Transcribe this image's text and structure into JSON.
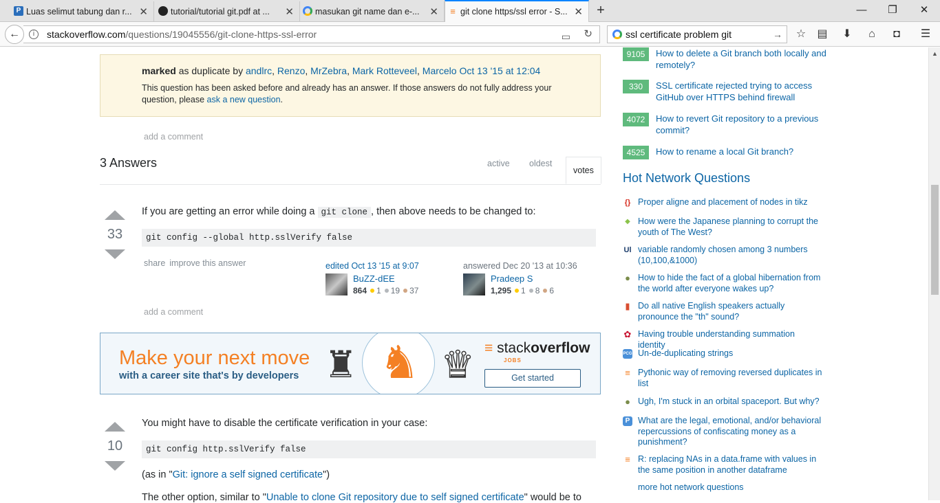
{
  "tabs": [
    {
      "title": "Luas selimut tabung dan r...",
      "icon": "p-icon",
      "color": "#2a6ebb"
    },
    {
      "title": "tutorial/tutorial git.pdf at ...",
      "icon": "github-icon",
      "color": "#222222"
    },
    {
      "title": "masukan git name dan e-...",
      "icon": "google-icon",
      "color": "#4285f4"
    },
    {
      "title": "git clone https/ssl error - S...",
      "icon": "stackoverflow-icon",
      "color": "#f48024"
    }
  ],
  "url": {
    "domain": "stackoverflow.com",
    "path": "/questions/19045556/git-clone-https-ssl-error"
  },
  "search": {
    "value": "ssl certificate problem git"
  },
  "duplicate": {
    "marked": "marked",
    "as_dup": " as duplicate by ",
    "users": [
      "andlrc",
      "Renzo",
      "MrZebra",
      "Mark Rotteveel",
      "Marcelo"
    ],
    "date": "Oct 13 '15 at 12:04",
    "msg": "This question has been asked before and already has an answer. If those answers do not fully address your question, please ",
    "ask": "ask a new question",
    "period": "."
  },
  "add_comment": "add a comment",
  "answers_title": "3 Answers",
  "sort_tabs": [
    "active",
    "oldest",
    "votes"
  ],
  "answer1": {
    "votes": "33",
    "text_a": "If you are getting an error while doing a ",
    "inline": "git clone",
    "text_b": ", then above needs to be changed to:",
    "code": "git config --global http.sslVerify false",
    "share": "share",
    "improve": "improve this answer",
    "edited": "edited Oct 13 '15 at 9:07",
    "editor": "BuZZ-dEE",
    "editor_rep": "864",
    "editor_g": "1",
    "editor_s": "19",
    "editor_b": "37",
    "answered": "answered Dec 20 '13 at 10:36",
    "author": "Pradeep S",
    "author_rep": "1,295",
    "author_g": "1",
    "author_s": "8",
    "author_b": "6"
  },
  "ad": {
    "h1": "Make your next move",
    "h2": "with a career site that's by developers",
    "logo_a": "stack",
    "logo_b": "overflow",
    "jobs": "JOBS",
    "btn": "Get started"
  },
  "answer2": {
    "votes": "10",
    "text": "You might have to disable the certificate verification in your case:",
    "code": "git config http.sslVerify false",
    "as_in_a": "(as in \"",
    "as_in_link": "Git: ignore a self signed certificate",
    "as_in_b": "\")",
    "other_a": "The other option, similar to \"",
    "other_link": "Unable to clone Git repository due to self signed certificate",
    "other_b": "\" would be to"
  },
  "related": [
    {
      "score": "9105",
      "title": "How to delete a Git branch both locally and remotely?"
    },
    {
      "score": "330",
      "title": "SSL certificate rejected trying to access GitHub over HTTPS behind firewall"
    },
    {
      "score": "4072",
      "title": "How to revert Git repository to a previous commit?"
    },
    {
      "score": "4525",
      "title": "How to rename a local Git branch?"
    }
  ],
  "hnq_title": "Hot Network Questions",
  "hnq": [
    {
      "icon": "tex-icon",
      "color": "#d62d20",
      "glyph": "{}",
      "title": "Proper aligne and placement of nodes in tikz"
    },
    {
      "icon": "history-icon",
      "color": "#8bc34a",
      "glyph": "◆",
      "title": "How were the Japanese planning to corrupt the youth of The West?"
    },
    {
      "icon": "cs-icon",
      "color": "#1b3c6b",
      "glyph": "Ul",
      "title": "variable randomly chosen among 3 numbers (10,100,&1000)"
    },
    {
      "icon": "worldbuilding-icon",
      "color": "#7a8c4a",
      "glyph": "●",
      "title": "How to hide the fact of a global hibernation from the world after everyone wakes up?"
    },
    {
      "icon": "english-icon",
      "color": "#d94e32",
      "glyph": "▮",
      "title": "Do all native English speakers actually pronounce the \"th\" sound?"
    },
    {
      "icon": "math-icon",
      "color": "#c8102e",
      "glyph": "✿",
      "title": "Having trouble understanding summation identity"
    },
    {
      "icon": "pcg-icon",
      "color": "#4a90d9",
      "glyph": "PCG",
      "title": "Un-de-duplicating strings"
    },
    {
      "icon": "stackoverflow-icon",
      "color": "#f48024",
      "glyph": "≡",
      "title": "Pythonic way of removing reversed duplicates in list"
    },
    {
      "icon": "worldbuilding-icon",
      "color": "#7a8c4a",
      "glyph": "●",
      "title": "Ugh, I'm stuck in an orbital spaceport. But why?"
    },
    {
      "icon": "personalfinance-icon",
      "color": "#4a90d9",
      "glyph": "P",
      "title": "What are the legal, emotional, and/or behavioral repercussions of confiscating money as a punishment?"
    },
    {
      "icon": "stackoverflow-icon",
      "color": "#f48024",
      "glyph": "≡",
      "title": "R: replacing NAs in a data.frame with values in the same position in another dataframe"
    }
  ],
  "more_hnq": "more hot network questions"
}
